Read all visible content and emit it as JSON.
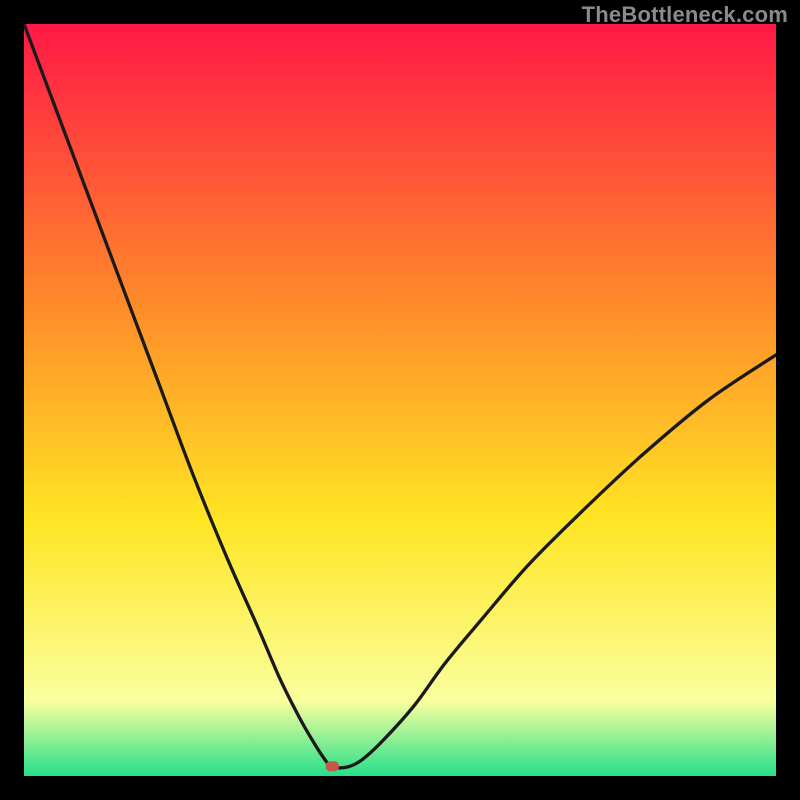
{
  "watermark": "TheBottleneck.com",
  "chart_data": {
    "type": "line",
    "title": "",
    "xlabel": "",
    "ylabel": "",
    "xlim": [
      0,
      100
    ],
    "ylim": [
      0,
      100
    ],
    "grid": false,
    "legend": false,
    "background_gradient": {
      "top": "#ff1846",
      "mid_upper": "#ff8d2a",
      "mid": "#ffe524",
      "lower": "#faff9e",
      "bottom": "#26e08a"
    },
    "marker": {
      "x": 41,
      "y": 1.3,
      "color": "#c15a4d"
    },
    "series": [
      {
        "name": "bottleneck-curve",
        "x": [
          0,
          4.5,
          9,
          13.5,
          18,
          22.5,
          27,
          31,
          34,
          36.5,
          38.5,
          40,
          41,
          43,
          45,
          48,
          52,
          56,
          61,
          67,
          74,
          82,
          91,
          100
        ],
        "y": [
          100,
          88,
          76,
          64,
          52,
          40,
          29,
          20,
          13,
          8,
          4.5,
          2.2,
          1.2,
          1.2,
          2.2,
          5,
          9.5,
          15,
          21,
          28,
          35,
          42.5,
          50,
          56
        ]
      }
    ]
  }
}
